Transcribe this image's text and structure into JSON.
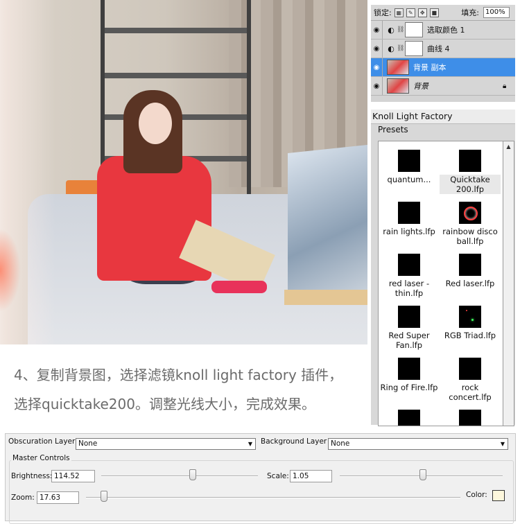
{
  "layers": {
    "lock_label": "锁定:",
    "fill_label": "填充:",
    "fill_value": "100%",
    "items": [
      {
        "name": "选取颜色 1",
        "selected": false
      },
      {
        "name": "曲线 4",
        "selected": false
      },
      {
        "name": "背景 副本",
        "selected": true
      },
      {
        "name": "背景",
        "selected": false
      }
    ]
  },
  "knoll": {
    "title": "Knoll Light Factory",
    "presets_label": "Presets",
    "presets": [
      {
        "name": "quantum...",
        "icon": "quantum-flare-icon"
      },
      {
        "name": "Quicktake 200.lfp",
        "icon": "quicktake-flare-icon"
      },
      {
        "name": "rain lights.lfp",
        "icon": "rain-lights-icon"
      },
      {
        "name": "rainbow disco ball.lfp",
        "icon": "rainbow-disco-ball-icon"
      },
      {
        "name": "red laser - thin.lfp",
        "icon": "red-laser-thin-icon"
      },
      {
        "name": "Red laser.lfp",
        "icon": "red-laser-icon"
      },
      {
        "name": "Red Super Fan.lfp",
        "icon": "red-super-fan-icon"
      },
      {
        "name": "RGB Triad.lfp",
        "icon": "rgb-triad-icon"
      },
      {
        "name": "Ring of Fire.lfp",
        "icon": "ring-of-fire-icon"
      },
      {
        "name": "rock concert.lfp",
        "icon": "rock-concert-icon"
      }
    ],
    "selected_preset": "Quicktake 200.lfp"
  },
  "caption": {
    "line1": "4、复制背景图，选择滤镜knoll light factory 插件，",
    "line2": "选择quicktake200。调整光线大小，完成效果。"
  },
  "controls": {
    "obscuration_label": "Obscuration Layer",
    "obscuration_value": "None",
    "background_label": "Background Layer",
    "background_value": "None",
    "master_label": "Master Controls",
    "brightness_label": "Brightness:",
    "brightness_value": "114.52",
    "scale_label": "Scale:",
    "scale_value": "1.05",
    "zoom_label": "Zoom:",
    "zoom_value": "17.63",
    "color_label": "Color:",
    "color_value": "#fdf7dc"
  }
}
